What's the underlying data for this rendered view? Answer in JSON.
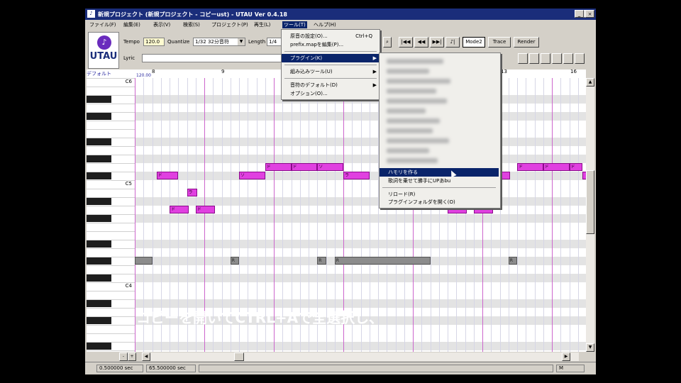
{
  "window": {
    "title": "新規プロジェクト (新規プロジェクト - コピーust) - UTAU Ver 0.4.18",
    "controls": {
      "minimize": "_",
      "maximize": "□",
      "close": "×"
    }
  },
  "menubar": [
    "ファイル(F)",
    "編集(E)",
    "表示(V)",
    "検索(S)",
    "プロジェクト(P)",
    "再生(L)",
    "ツール(T)",
    "ヘルプ(H)"
  ],
  "toolbar": {
    "logo_text": "UTAU",
    "tempo_label": "Tempo",
    "tempo_value": "120.0",
    "quantize_label": "Quantize",
    "quantize_value": "1/32 32分音符",
    "length_label": "Length",
    "length_value": "1/4",
    "lyric_label": "Lyric",
    "lyric_value": "",
    "buttons": [
      "Mode2",
      "Trace",
      "Render"
    ],
    "transport": [
      "|◀◀",
      "◀◀",
      "▶▶|",
      "♪|"
    ]
  },
  "editor": {
    "track_label": "デフォルト",
    "tempo_marker": "120.00",
    "measures": [
      "8",
      "9",
      "13",
      "16"
    ],
    "octaves": [
      "C6",
      "C5",
      "C4"
    ],
    "notes_pink": [
      {
        "pitch_row": 11,
        "start": 2.5,
        "len": 2.5,
        "text": "ド"
      },
      {
        "pitch_row": 11,
        "start": 12,
        "len": 3,
        "text": "ソ"
      },
      {
        "pitch_row": 10,
        "start": 15,
        "len": 3,
        "text": "ド"
      },
      {
        "pitch_row": 10,
        "start": 18,
        "len": 3,
        "text": "ド"
      },
      {
        "pitch_row": 10,
        "start": 21,
        "len": 3,
        "text": "ソ"
      },
      {
        "pitch_row": 11,
        "start": 24,
        "len": 3,
        "text": "ラ"
      },
      {
        "pitch_row": 13,
        "start": 6,
        "len": 1.2,
        "text": "ラ"
      },
      {
        "pitch_row": 15,
        "start": 4,
        "len": 2.2,
        "text": "ド"
      },
      {
        "pitch_row": 15,
        "start": 7,
        "len": 2.2,
        "text": "ド"
      },
      {
        "pitch_row": 15,
        "start": 36,
        "len": 2.2,
        "text": ""
      },
      {
        "pitch_row": 15,
        "start": 39,
        "len": 2.2,
        "text": ""
      },
      {
        "pitch_row": 11,
        "start": 42,
        "len": 1.2,
        "text": ""
      },
      {
        "pitch_row": 10,
        "start": 44,
        "len": 3,
        "text": "ド"
      },
      {
        "pitch_row": 10,
        "start": 47,
        "len": 3,
        "text": "ド"
      },
      {
        "pitch_row": 10,
        "start": 50,
        "len": 1.5,
        "text": "ド"
      },
      {
        "pitch_row": 11,
        "start": 51.5,
        "len": 1,
        "text": ""
      }
    ],
    "notes_gray": [
      {
        "pitch_row": 21,
        "start": 0,
        "len": 2,
        "text": ""
      },
      {
        "pitch_row": 21,
        "start": 11,
        "len": 1,
        "text": "R"
      },
      {
        "pitch_row": 21,
        "start": 21,
        "len": 1,
        "text": "R"
      },
      {
        "pitch_row": 21,
        "start": 23,
        "len": 11,
        "text": "R"
      },
      {
        "pitch_row": 21,
        "start": 43,
        "len": 1,
        "text": "R"
      }
    ]
  },
  "tools_menu": {
    "items": [
      {
        "label": "原音の設定(O)...",
        "shortcut": "Ctrl+Q"
      },
      {
        "label": "prefix.mapを編集(P)...",
        "shortcut": ""
      },
      {
        "label": "プラグイン(K)",
        "shortcut": "",
        "submenu": true,
        "highlight": true
      },
      {
        "label": "組み込みツール(U)",
        "shortcut": "",
        "submenu": true
      },
      {
        "label": "音符のデフォルト(D)",
        "shortcut": "",
        "submenu": true
      },
      {
        "label": "オプション(O)...",
        "shortcut": ""
      }
    ]
  },
  "plugin_submenu": {
    "items": [
      {
        "label": "ハモリを作る",
        "highlight": true
      },
      {
        "label": "歌詞を乗せて勝手にUPあbu"
      },
      {
        "label": "リロード(R)"
      },
      {
        "label": "プラグインフォルダを開く(O)"
      }
    ]
  },
  "hscroll": {
    "left": "◀",
    "right": "▶"
  },
  "vscroll": {
    "up": "▲",
    "down": "▼"
  },
  "status": {
    "position": "0.500000 sec",
    "length": "65.500000 sec",
    "mode": "M"
  },
  "caption": "コピーを開いてCTRL+Aで全選択し、"
}
